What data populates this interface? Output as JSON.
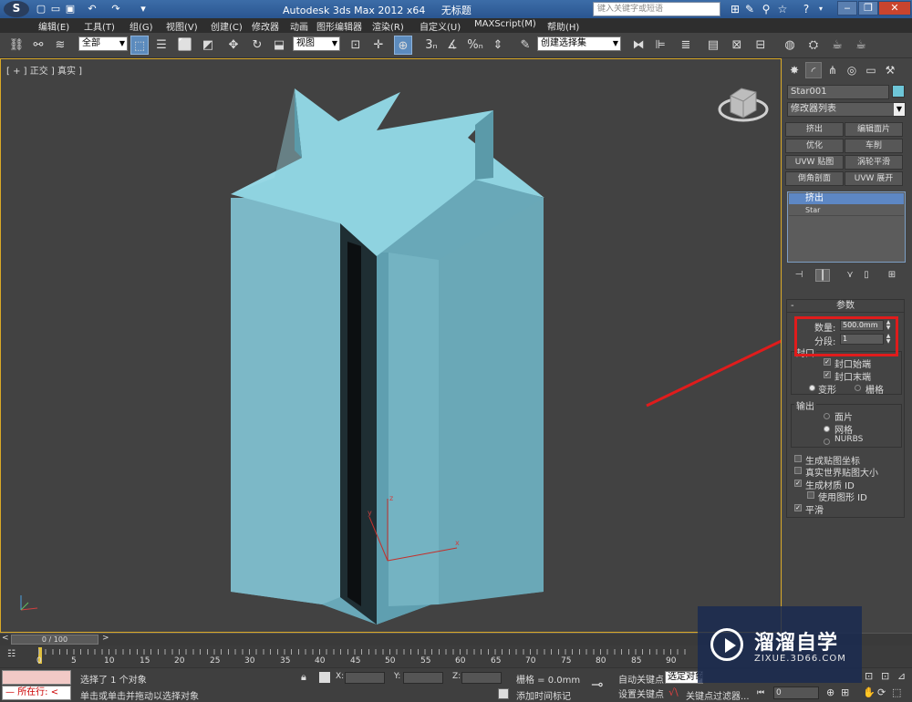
{
  "title_bar": {
    "app_title": "Autodesk 3ds Max  2012 x64",
    "file_name": "无标题",
    "search_placeholder": "键入关键字或短语"
  },
  "menu": [
    "编辑(E)",
    "工具(T)",
    "组(G)",
    "视图(V)",
    "创建(C)",
    "修改器",
    "动画",
    "图形编辑器",
    "渲染(R)",
    "自定义(U)",
    "MAXScript(M)",
    "帮助(H)"
  ],
  "toolbar": {
    "selection_filter": "全部",
    "ref_coord": "视图",
    "named_selection": "创建选择集",
    "snap_3": "3",
    "percent_snap": "%"
  },
  "viewport": {
    "label": "[ + ] 正交 ] 真实 ]",
    "axis_x": "x",
    "axis_y": "y",
    "axis_z": "z"
  },
  "command_panel": {
    "object_name": "Star001",
    "object_color": "#6ec6d8",
    "modifier_list": "修改器列表",
    "modifier_buttons": [
      "挤出",
      "编辑面片",
      "优化",
      "车削",
      "UVW 贴图",
      "涡轮平滑",
      "倒角剖面",
      "UVW 展开"
    ],
    "stack": [
      "挤出",
      "Star"
    ],
    "rollout_title": "参数",
    "params": {
      "amount_label": "数量:",
      "amount_value": "500.0mm",
      "segments_label": "分段:",
      "segments_value": "1"
    },
    "capping": {
      "title": "封口",
      "cap_start": "封口始端",
      "cap_end": "封口末端",
      "morph": "变形",
      "grid": "栅格"
    },
    "output": {
      "title": "输出",
      "patch": "面片",
      "mesh": "网格",
      "nurbs": "NURBS"
    },
    "options": {
      "gen_map": "生成贴图坐标",
      "real_world": "真实世界贴图大小",
      "gen_mat": "生成材质 ID",
      "use_shape": "使用图形 ID",
      "smooth": "平滑"
    }
  },
  "time_slider": {
    "frame": "0 / 100",
    "ticks": [
      "0",
      "5",
      "10",
      "15",
      "20",
      "25",
      "30",
      "35",
      "40",
      "45",
      "50",
      "55",
      "60",
      "65",
      "70",
      "75",
      "80",
      "85",
      "90"
    ]
  },
  "status": {
    "listener": "所在行:",
    "selected": "选择了 1 个对象",
    "prompt": "单击或单击并拖动以选择对象",
    "x_label": "X:",
    "y_label": "Y:",
    "z_label": "Z:",
    "grid": "栅格 = 0.0mm",
    "add_time_tag": "添加时间标记",
    "auto_key": "自动关键点",
    "set_key": "设置关键点",
    "key_select": "选定对象",
    "key_filters": "关键点过滤器...",
    "frame_value": "0"
  },
  "watermark": {
    "title": "溜溜自学",
    "url": "ZIXUE.3D66.COM"
  }
}
